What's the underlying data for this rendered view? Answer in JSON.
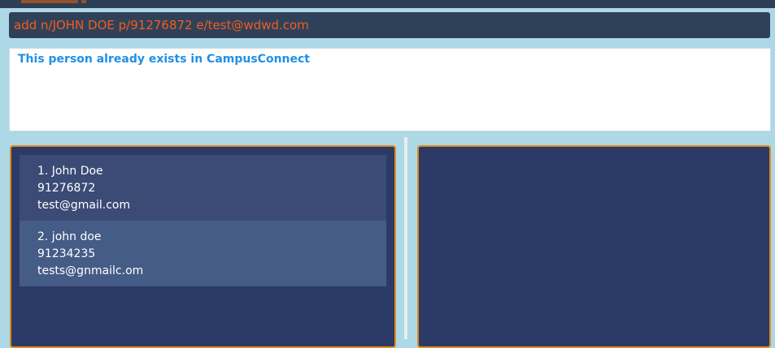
{
  "command_box": {
    "value": "add n/JOHN DOE p/91276872 e/test@wdwd.com"
  },
  "result_display": {
    "message": "This person already exists in CampusConnect"
  },
  "person_list": [
    {
      "index_name": "1. John Doe",
      "phone": "91276872",
      "email": "test@gmail.com"
    },
    {
      "index_name": "2. john doe",
      "phone": "91234235",
      "email": "tests@gnmailc.om"
    }
  ],
  "colors": {
    "background": "#add8e6",
    "command_bg": "#2f4159",
    "command_text": "#f25c1c",
    "result_text": "#1e90e6",
    "panel_bg": "#2c3a67",
    "panel_border": "#e08a1e"
  }
}
